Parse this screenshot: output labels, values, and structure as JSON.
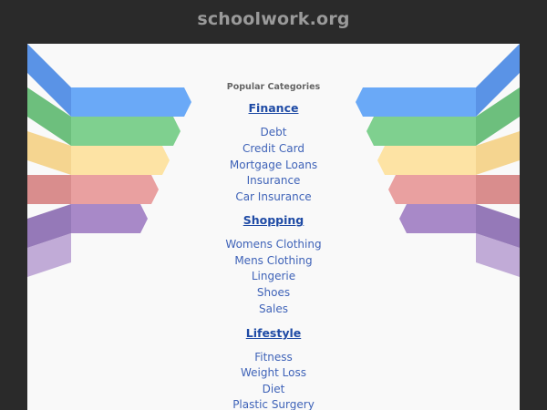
{
  "site": {
    "title": "schoolwork.org"
  },
  "sidebar": {
    "heading": "Popular Categories"
  },
  "categories": [
    {
      "title": "Finance",
      "links": [
        "Debt",
        "Credit Card",
        "Mortgage Loans",
        "Insurance",
        "Car Insurance"
      ]
    },
    {
      "title": "Shopping",
      "links": [
        "Womens Clothing",
        "Mens Clothing",
        "Lingerie",
        "Shoes",
        "Sales"
      ]
    },
    {
      "title": "Lifestyle",
      "links": [
        "Fitness",
        "Weight Loss",
        "Diet",
        "Plastic Surgery"
      ]
    }
  ],
  "colors": {
    "background": "#2a2a2a",
    "panel": "#f9f9f9",
    "title_text": "#9a9a9a",
    "category_title": "#1f4ba5",
    "category_link": "#3f63b8",
    "ribbon_blue": "#6aa9f7",
    "ribbon_green": "#7fd08f",
    "ribbon_yellow": "#fde3a4",
    "ribbon_red": "#e9a0a0",
    "ribbon_purple": "#a889c8"
  }
}
